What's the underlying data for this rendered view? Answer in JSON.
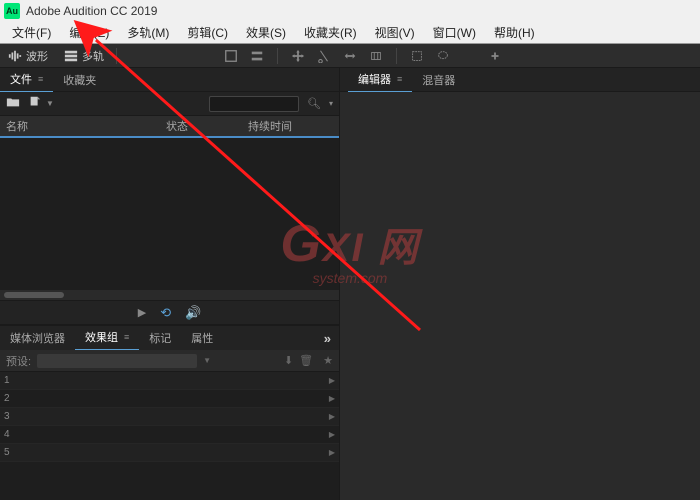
{
  "titlebar": {
    "app_icon_text": "Au",
    "title": "Adobe Audition CC 2019"
  },
  "menubar": {
    "items": [
      "文件(F)",
      "编辑(E)",
      "多轨(M)",
      "剪辑(C)",
      "效果(S)",
      "收藏夹(R)",
      "视图(V)",
      "窗口(W)",
      "帮助(H)"
    ]
  },
  "toolbar": {
    "waveform_label": "波形",
    "multitrack_label": "多轨"
  },
  "files_panel": {
    "tab_files": "文件",
    "tab_favorites": "收藏夹",
    "col_name": "名称",
    "col_status": "状态",
    "col_duration": "持续时间"
  },
  "bottom_panel": {
    "tab_media_browser": "媒体浏览器",
    "tab_fx_rack": "效果组",
    "tab_markers": "标记",
    "tab_properties": "属性",
    "preset_label": "预设:",
    "slots": [
      "1",
      "2",
      "3",
      "4",
      "5"
    ]
  },
  "editor_panel": {
    "tab_editor": "编辑器",
    "tab_mixer": "混音器"
  },
  "watermark": {
    "main": "GXI 网",
    "sub": "system.com"
  }
}
